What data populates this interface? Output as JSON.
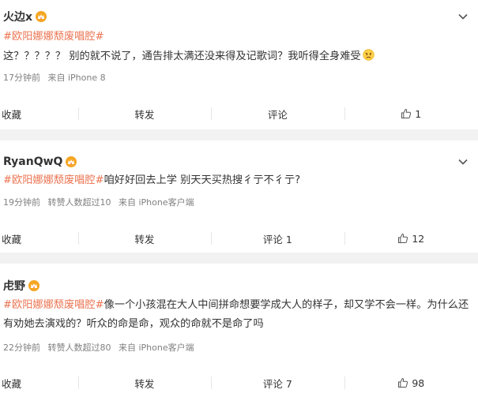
{
  "colors": {
    "tag": "#eb7350",
    "meta": "#808080",
    "separator": "#f2f2f2"
  },
  "posts": [
    {
      "username": "火边x",
      "tag": "#欧阳娜娜颓废唱腔#",
      "text": "这？？？？？ 别的就不说了，通告排太满还没来得及记歌词？我听得全身难受",
      "emoji": "angry-face-emoji",
      "time": "17分钟前",
      "source": "来自 iPhone 8",
      "actions": {
        "favorite": "收藏",
        "repost": "转发",
        "comment": "评论",
        "like_count": "1"
      }
    },
    {
      "username": "RyanQwQ",
      "tag": "#欧阳娜娜颓废唱腔#",
      "text": "咱好好回去上学 别天天买热搜彳亍不彳亍?",
      "time": "19分钟前",
      "extra": "转赞人数超过10",
      "source": "来自 iPhone客户端",
      "actions": {
        "favorite": "收藏",
        "repost": "转发",
        "comment": "评论 1",
        "like_count": "12"
      }
    },
    {
      "username": "虍野",
      "tag": "#欧阳娜娜颓废唱腔#",
      "text": "像一个小孩混在大人中间拼命想要学成大人的样子，却又学不会一样。为什么还有劝她去演戏的？听众的命是命，观众的命就不是命了吗",
      "time": "22分钟前",
      "extra": "转赞人数超过80",
      "source": "来自 iPhone客户端",
      "actions": {
        "favorite": "收藏",
        "repost": "转发",
        "comment": "评论 7",
        "like_count": "98"
      }
    }
  ]
}
